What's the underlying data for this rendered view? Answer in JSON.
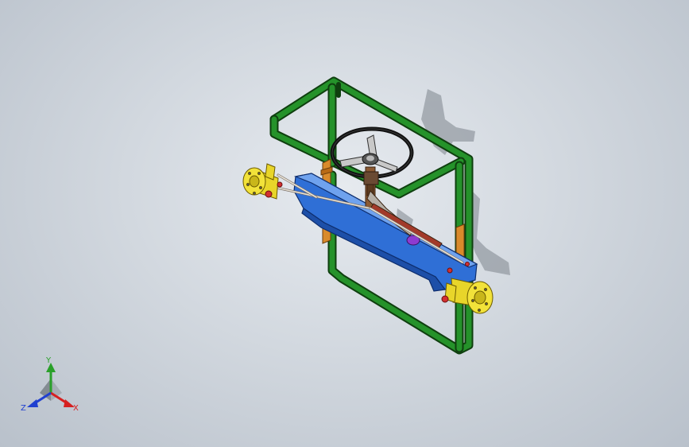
{
  "viewport": {
    "background_top": "#e6eaef",
    "background_bottom": "#b9c1cb"
  },
  "model": {
    "frame_color": "#1e7f1e",
    "axle_color": "#2f6fd6",
    "hub_color": "#f2e23a",
    "bracket_color": "#d98a2b",
    "wheel_color": "#111111"
  },
  "triad": {
    "y_label": "Y",
    "x_label": "X",
    "z_label": "Z",
    "y_color": "#2aa02a",
    "x_color": "#d62020",
    "z_color": "#2040d0"
  }
}
